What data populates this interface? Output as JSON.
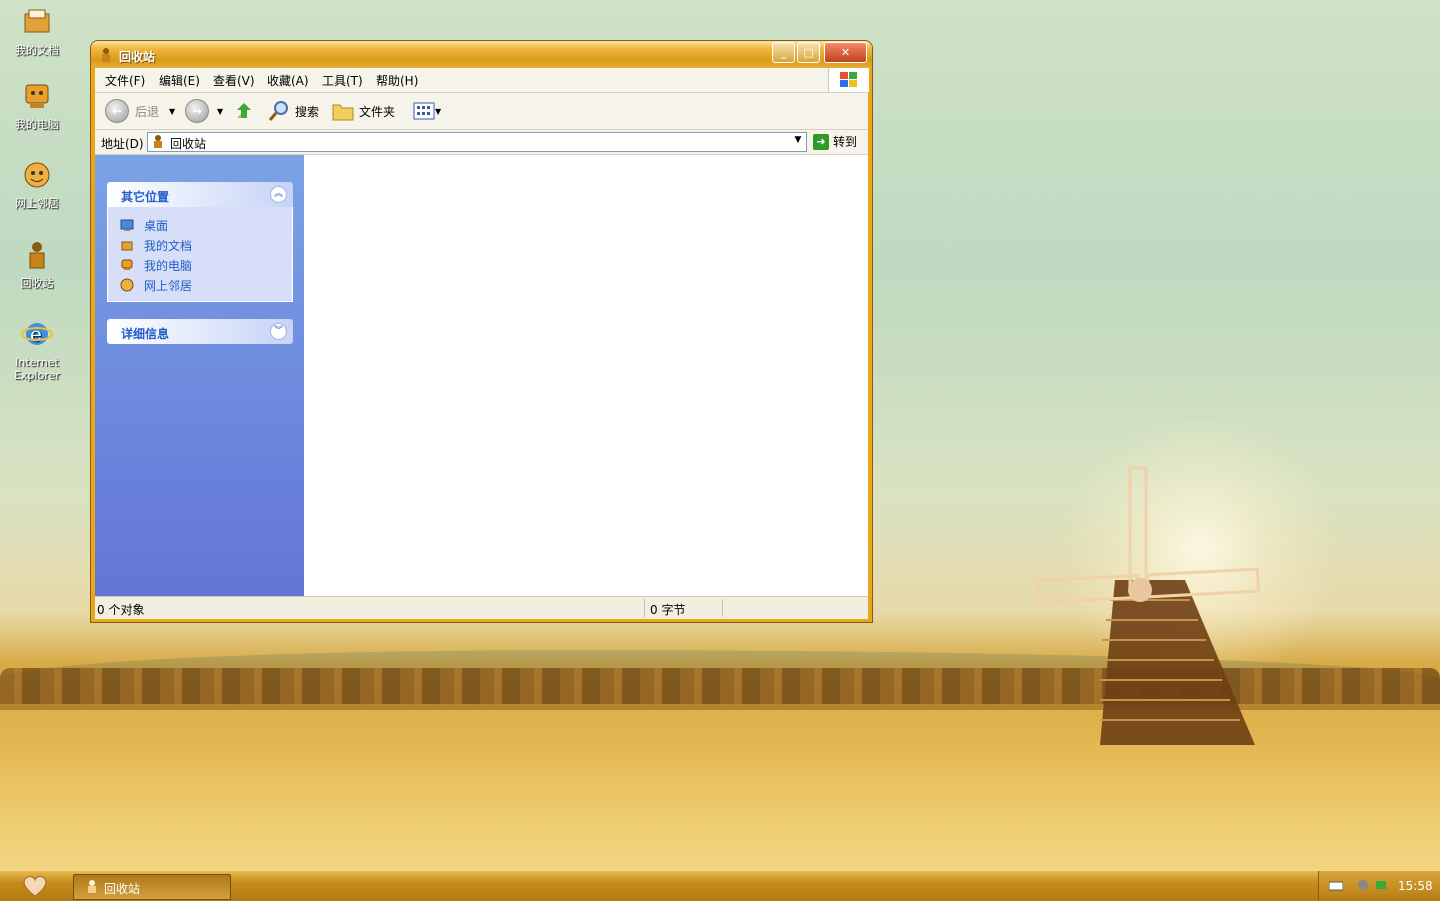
{
  "desktop": {
    "icons": [
      {
        "label": "我的文档"
      },
      {
        "label": "我的电脑"
      },
      {
        "label": "网上邻居"
      },
      {
        "label": "回收站"
      },
      {
        "label": "Internet Explorer"
      }
    ]
  },
  "window": {
    "title": "回收站",
    "controls": {
      "minimize": "0",
      "maximize": "1",
      "close": "r"
    },
    "menu": [
      "文件(F)",
      "编辑(E)",
      "查看(V)",
      "收藏(A)",
      "工具(T)",
      "帮助(H)"
    ],
    "toolbar": {
      "back": "后退",
      "search": "搜索",
      "folders": "文件夹"
    },
    "address": {
      "label": "地址(D)",
      "value": "回收站",
      "go": "转到"
    },
    "sidepane": {
      "other_places": {
        "title": "其它位置",
        "links": [
          "桌面",
          "我的文档",
          "我的电脑",
          "网上邻居"
        ]
      },
      "details": {
        "title": "详细信息"
      }
    },
    "status": {
      "objects": "0 个对象",
      "size": "0 字节"
    }
  },
  "taskbar": {
    "task": "回收站",
    "clock": "15:58"
  }
}
